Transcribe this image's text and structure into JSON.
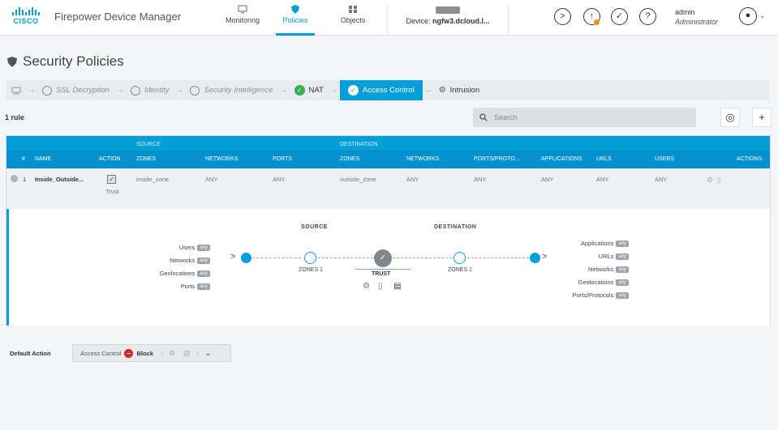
{
  "header": {
    "logo_text": "CISCO",
    "app_title": "Firepower Device Manager",
    "nav": [
      {
        "label": "Monitoring"
      },
      {
        "label": "Policies"
      },
      {
        "label": "Objects"
      }
    ],
    "device_label": "Device:",
    "device_name": "ngfw3.dcloud.l...",
    "user_name": "admin",
    "user_role": "Administrator"
  },
  "page": {
    "title": "Security Policies"
  },
  "steps": [
    {
      "label": "SSL Decryption"
    },
    {
      "label": "Identity"
    },
    {
      "label": "Security Intelligence"
    },
    {
      "label": "NAT"
    },
    {
      "label": "Access Control"
    },
    {
      "label": "Intrusion"
    }
  ],
  "toolbar": {
    "rule_count": "1 rule",
    "search_placeholder": "Search"
  },
  "table": {
    "group_headers": {
      "source": "SOURCE",
      "destination": "DESTINATION"
    },
    "columns": [
      "#",
      "NAME",
      "ACTION",
      "ZONES",
      "NETWORKS",
      "PORTS",
      "ZONES",
      "NETWORKS",
      "PORTS/PROTO...",
      "APPLICATIONS",
      "URLS",
      "USERS",
      "ACTIONS"
    ],
    "rows": [
      {
        "num": "1",
        "name": "Inside_Outside...",
        "action": "Trust",
        "src_zones": "inside_zone",
        "src_networks": "ANY",
        "src_ports": "ANY",
        "dst_zones": "outside_zone",
        "dst_networks": "ANY",
        "dst_ports": "ANY",
        "applications": "ANY",
        "urls": "ANY",
        "users": "ANY"
      }
    ]
  },
  "flow": {
    "source_label": "SOURCE",
    "destination_label": "DESTINATION",
    "left_items": [
      "Users",
      "Networks",
      "Geolocations",
      "Ports"
    ],
    "right_items": [
      "Applications",
      "URLs",
      "Networks",
      "Geolocations",
      "Ports/Protocols"
    ],
    "any_badge": "any",
    "src_zones": "ZONES 1",
    "dst_zones": "ZONES 1",
    "action": "TRUST"
  },
  "default_action": {
    "label": "Default Action",
    "prefix": "Access Control",
    "value": "Block"
  },
  "colors": {
    "accent": "#049fd9",
    "success": "#36b04d",
    "block": "#d0282c"
  }
}
